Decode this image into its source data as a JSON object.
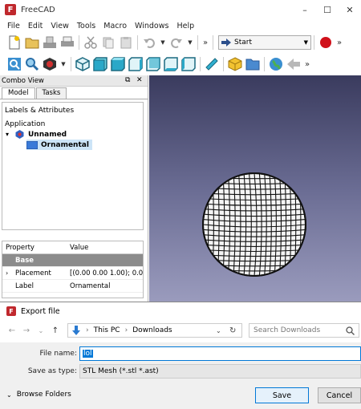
{
  "window": {
    "title": "FreeCAD",
    "icon_letter": "F"
  },
  "window_controls": {
    "minimize": "–",
    "maximize": "☐",
    "close": "✕"
  },
  "menu": [
    "File",
    "Edit",
    "View",
    "Tools",
    "Macro",
    "Windows",
    "Help"
  ],
  "toolbar": {
    "overflow": "»",
    "workbench": "Start"
  },
  "combo_view": {
    "title": "Combo View",
    "float_glyph": "⧉",
    "close_glyph": "✕",
    "tabs": [
      "Model",
      "Tasks"
    ],
    "labels_header": "Labels & Attributes",
    "tree": {
      "root": "Application",
      "document": "Unnamed",
      "object": "Ornamental"
    },
    "properties": {
      "headers": [
        "Property",
        "Value"
      ],
      "group": "Base",
      "rows": [
        {
          "name": "Placement",
          "value": "[(0.00 0.00 1.00); 0.0..."
        },
        {
          "name": "Label",
          "value": "Ornamental"
        }
      ]
    }
  },
  "export_dialog": {
    "title": "Export file",
    "breadcrumb": [
      "This PC",
      "Downloads"
    ],
    "search_placeholder": "Search Downloads",
    "file_name_label": "File name:",
    "file_name_value": "lol",
    "save_as_type_label": "Save as type:",
    "save_as_type_value": "STL Mesh (*.stl *.ast)",
    "browse_folders": "Browse Folders",
    "save": "Save",
    "cancel": "Cancel"
  },
  "colors": {
    "accent": "#0078d7",
    "view_top": "#3a3b5e",
    "view_bottom": "#9a9bbd",
    "freecad_red": "#c0282d"
  }
}
